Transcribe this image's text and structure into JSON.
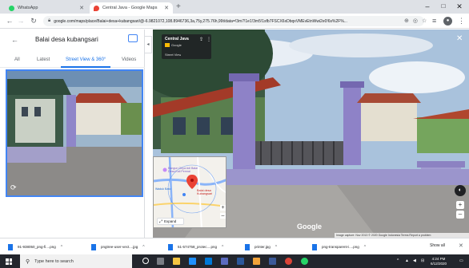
{
  "tabs": [
    {
      "title": "WhatsApp",
      "active": false,
      "favicon_color": "#25d366"
    },
    {
      "title": "Central Java - Google Maps",
      "active": true,
      "favicon_color": "#ea4335"
    }
  ],
  "window_controls": {
    "minimize": "–",
    "maximize": "□",
    "close": "✕"
  },
  "address_bar": {
    "url": "google.com/maps/place/Balai+desa+kubangsari/@-6.9821072,108.8946736,3a,75y,275.76h,99t/data=!3m7!1e1!3m5!1sfb7FSCX6xDbqxVMEvEtnWwi2e0!6s%2F%..."
  },
  "side_panel": {
    "title": "Balai desa kubangsari",
    "tabs": [
      {
        "label": "All",
        "active": false
      },
      {
        "label": "Latest",
        "active": false
      },
      {
        "label": "Street View & 360°",
        "active": true
      },
      {
        "label": "Videos",
        "active": false
      }
    ]
  },
  "street_view": {
    "card_title": "Central Java",
    "card_source": "Google",
    "card_label": "Street View",
    "expand_label": "Expand",
    "watermark": "Google",
    "attribution": "Image capture: Nov 2013   © 2020 Google   Indonesia   Terms   Report a problem"
  },
  "minimap": {
    "labels": [
      "Bangun Griya Adi Balai Desa Kali Permai",
      "Balai desa Kubangsari",
      "Waduk Bato"
    ]
  },
  "downloads": [
    {
      "name": "91-938050_png-fi....png"
    },
    {
      "name": "pngtree-user-vect....jpg"
    },
    {
      "name": "51-574758_protec....png"
    },
    {
      "name": "printer.jpg"
    },
    {
      "name": "png-transparent-i....png"
    }
  ],
  "downloads_show_all": "Show all",
  "taskbar": {
    "search_placeholder": "Type here to search",
    "time": "4:24 PM",
    "date": "6/12/2020"
  }
}
